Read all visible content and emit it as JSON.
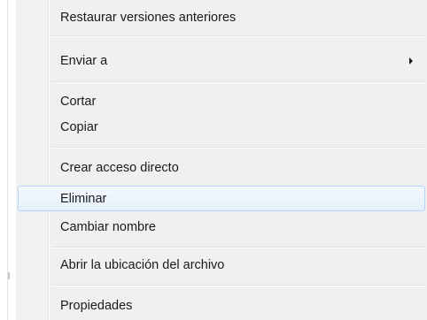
{
  "context_menu": {
    "items": [
      {
        "label": "Restaurar versiones anteriores",
        "has_submenu": false,
        "highlighted": false
      },
      {
        "label": "Enviar a",
        "has_submenu": true,
        "highlighted": false
      },
      {
        "label": "Cortar",
        "has_submenu": false,
        "highlighted": false
      },
      {
        "label": "Copiar",
        "has_submenu": false,
        "highlighted": false
      },
      {
        "label": "Crear acceso directo",
        "has_submenu": false,
        "highlighted": false
      },
      {
        "label": "Eliminar",
        "has_submenu": false,
        "highlighted": true
      },
      {
        "label": "Cambiar nombre",
        "has_submenu": false,
        "highlighted": false
      },
      {
        "label": "Abrir la ubicación del archivo",
        "has_submenu": false,
        "highlighted": false
      },
      {
        "label": "Propiedades",
        "has_submenu": false,
        "highlighted": false
      }
    ],
    "colors": {
      "menu_background": "#f0f0f0",
      "highlight_border": "#b8d6fb",
      "highlight_fill": "#e6f0fb",
      "text": "#1a1a1a"
    }
  }
}
